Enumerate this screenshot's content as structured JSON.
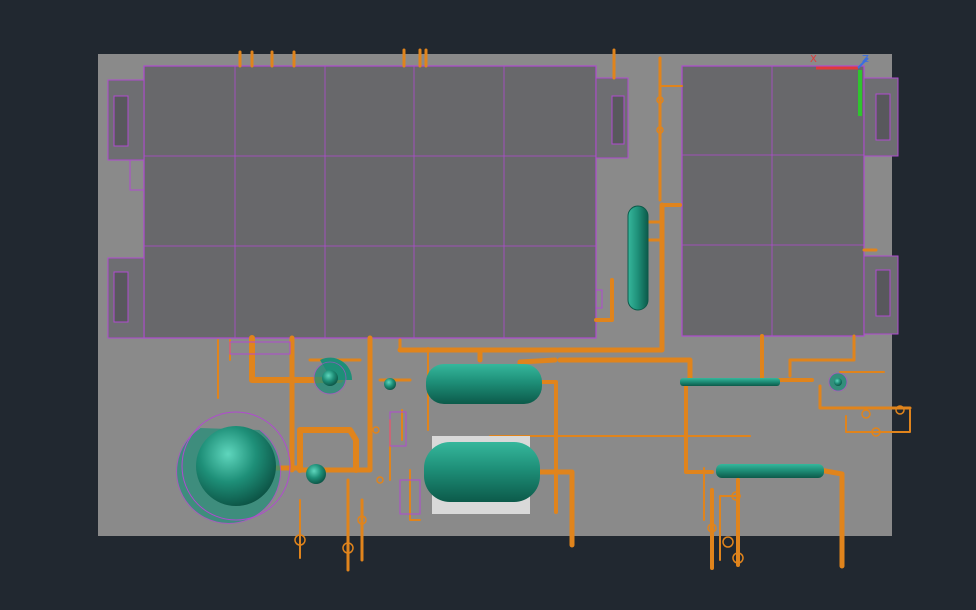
{
  "viewport": {
    "background": "#212830",
    "slab_color": "#8a8a8a",
    "tank_color": "#1e8f78",
    "pipe_color": "#e0841c",
    "frame_color": "#b04ad0",
    "roof_color": "#68686b"
  },
  "ucs": {
    "x_axis_color": "#e03a3a",
    "y_axis_color": "#2fc42f",
    "z_axis_color": "#3a6ee0",
    "x_label": "X",
    "z_label": "Z"
  }
}
